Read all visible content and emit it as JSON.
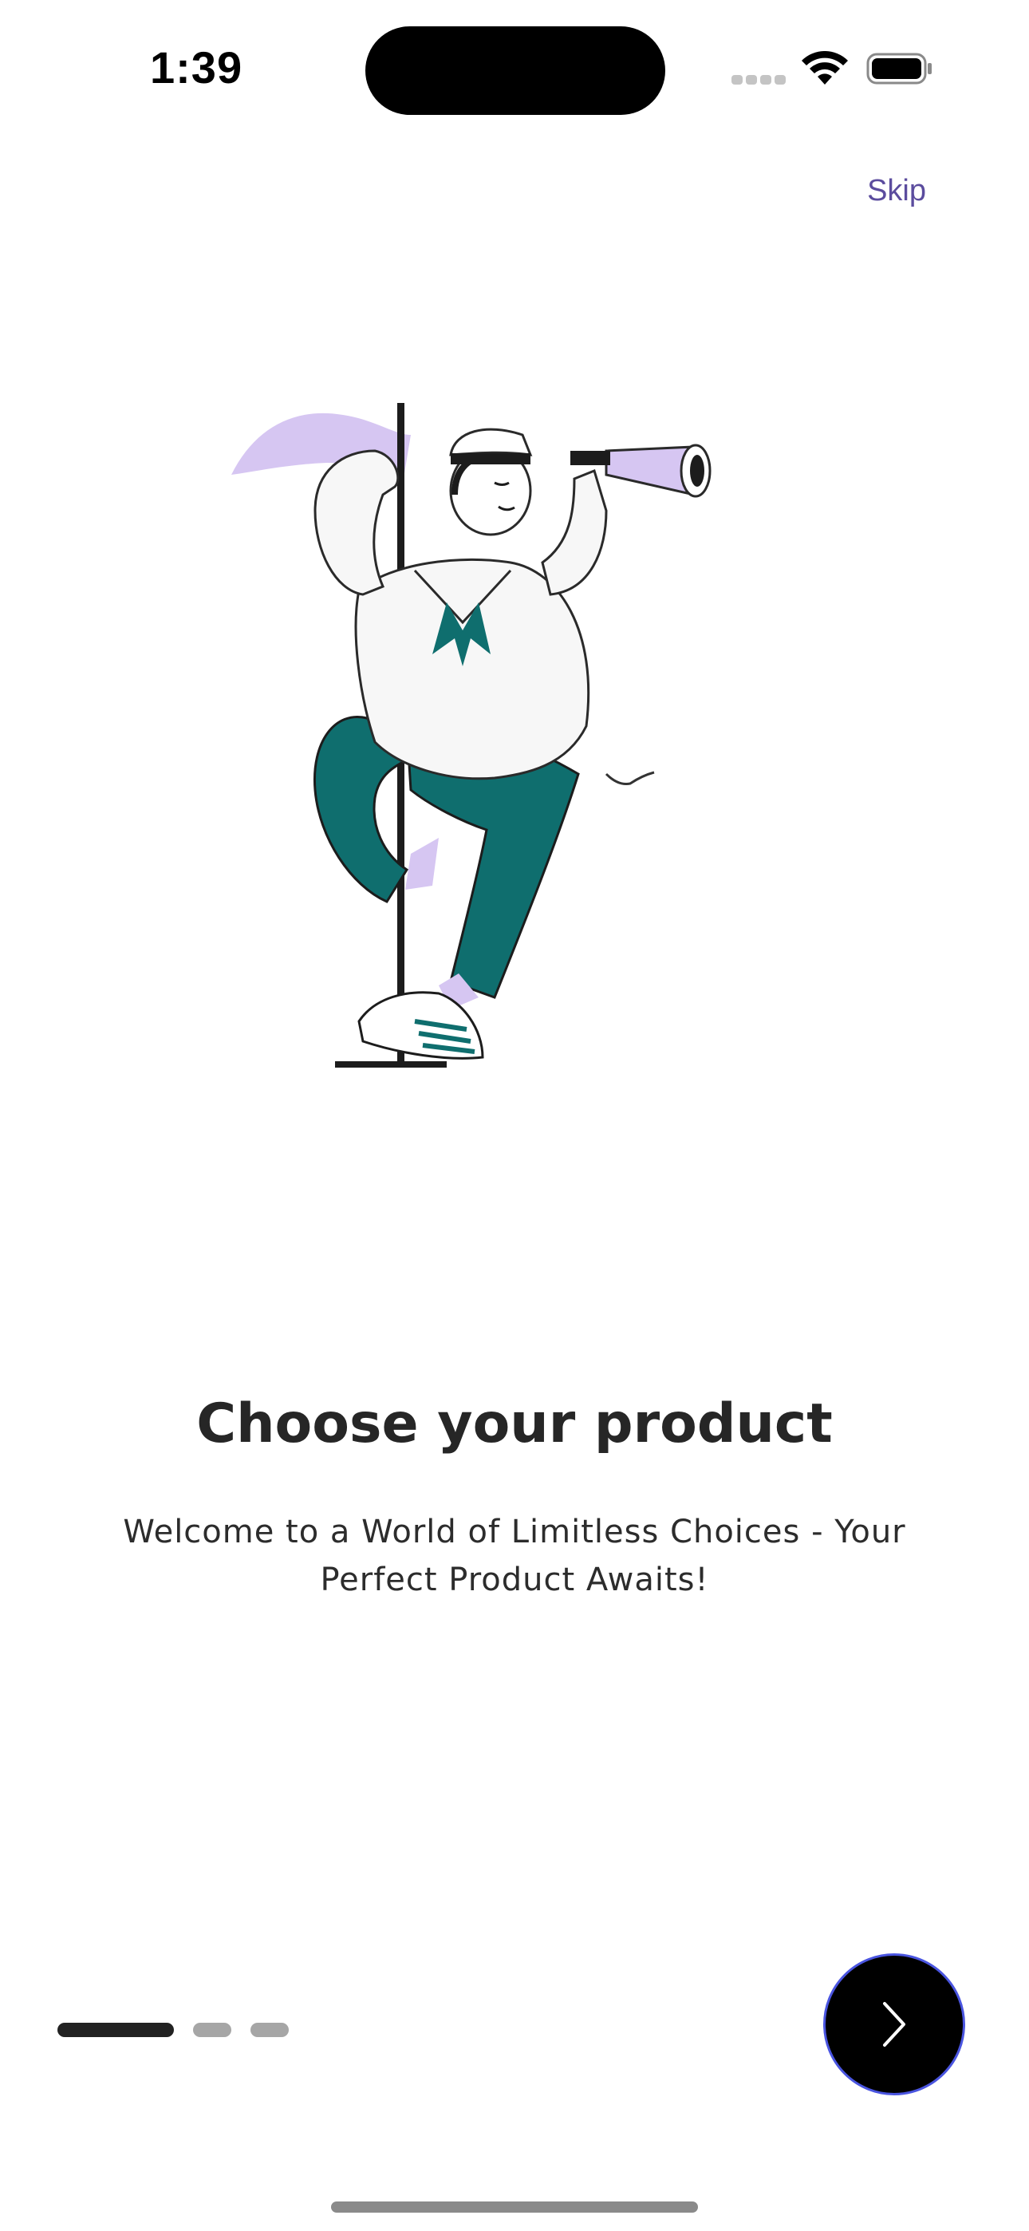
{
  "status_bar": {
    "time": "1:39",
    "icons": [
      "signal-icon",
      "wifi-icon",
      "battery-icon"
    ]
  },
  "onboarding": {
    "skip_label": "Skip",
    "title": "Choose your product",
    "subtitle_line1": "Welcome to a World of Limitless Choices - Your",
    "subtitle_line2": "Perfect Product Awaits!",
    "illustration": "sailor-with-telescope-illustration",
    "page_indicator": {
      "current": 1,
      "total": 3
    },
    "next_button_icon": "chevron-right-icon"
  },
  "colors": {
    "skip_text": "#5b4c9e",
    "title_text": "#262626",
    "active_dot": "#222222",
    "inactive_dot": "#a6a6a6",
    "next_button_bg": "#000000",
    "next_button_border": "#4a55e0",
    "teal": "#0f6e6e",
    "lavender": "#d6c6f2"
  }
}
